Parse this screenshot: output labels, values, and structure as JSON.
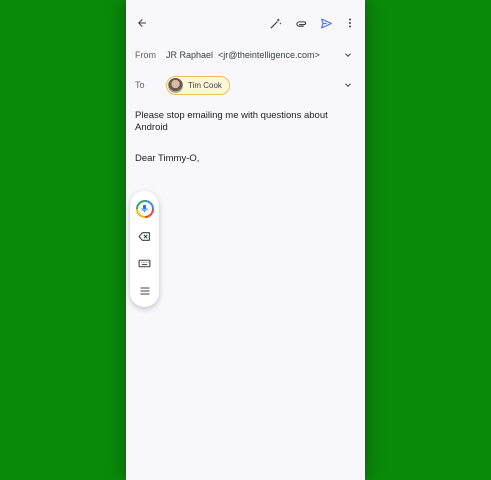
{
  "toolbar": {
    "back_icon": "arrow-left-icon",
    "magic_icon": "magic-wand-icon",
    "attach_icon": "paperclip-icon",
    "send_icon": "send-icon",
    "more_icon": "more-vert-icon"
  },
  "from": {
    "label": "From",
    "value": "JR Raphael  <jr@theintelligence.com>"
  },
  "to": {
    "label": "To",
    "recipient": "Tim Cook"
  },
  "subject": "Please stop emailing me with questions about Android",
  "body": "Dear Timmy-O,",
  "colors": {
    "background": "#0a8a0a",
    "send_accent": "#4a6cf7",
    "chip_border": "#e5c35a",
    "chip_bg": "#fff7d6"
  },
  "voice_toolbar": {
    "icons": [
      "microphone-icon",
      "backspace-icon",
      "keyboard-icon",
      "menu-icon"
    ]
  }
}
